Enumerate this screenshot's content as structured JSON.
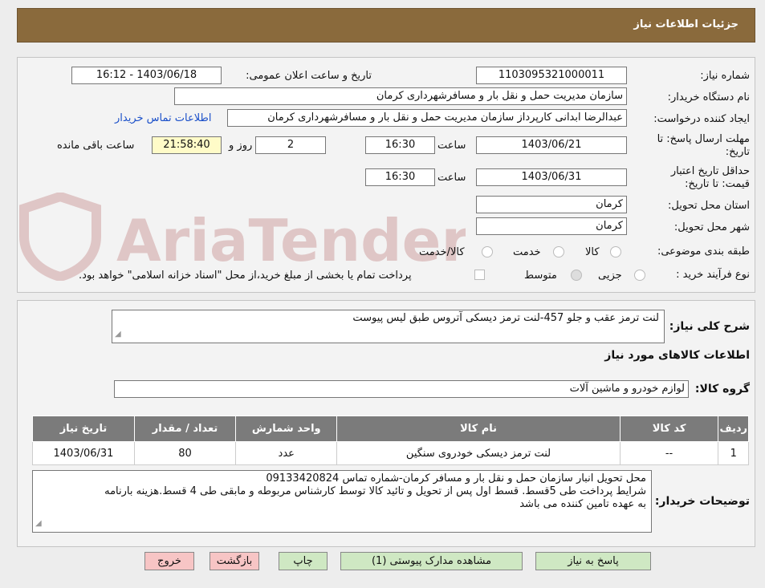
{
  "header": {
    "title": "جزئیات اطلاعات نیاز"
  },
  "form": {
    "need_number_label": "شماره نیاز:",
    "need_number": "1103095321000011",
    "announce_label": "تاریخ و ساعت اعلان عمومی:",
    "announce_value": "1403/06/18 - 16:12",
    "buyer_label": "نام دستگاه خریدار:",
    "buyer": "سازمان مدیریت حمل و نقل بار و مسافرشهرداری کرمان",
    "creator_label": "ایجاد کننده درخواست:",
    "creator": "عبدالرضا ابدانی کارپرداز سازمان مدیریت حمل و نقل بار و مسافرشهرداری کرمان",
    "contact_link": "اطلاعات تماس خریدار",
    "deadline_label": "مهلت ارسال پاسخ: تا تاریخ:",
    "deadline_date": "1403/06/21",
    "time_label": "ساعت",
    "deadline_time": "16:30",
    "days_value": "2",
    "days_label": "روز و",
    "remaining_time": "21:58:40",
    "remaining_label": "ساعت باقی مانده",
    "validity_label": "حداقل تاریخ اعتبار قیمت: تا تاریخ:",
    "validity_date": "1403/06/31",
    "validity_time": "16:30",
    "province_label": "استان محل تحویل:",
    "province": "کرمان",
    "city_label": "شهر محل تحویل:",
    "city": "کرمان",
    "category_label": "طبقه بندی موضوعی:",
    "cat_goods": "کالا",
    "cat_service": "خدمت",
    "cat_both": "کالا/خدمت",
    "process_label": "نوع فرآیند خرید :",
    "proc_partial": "جزیی",
    "proc_medium": "متوسط",
    "payment_note": "پرداخت تمام یا بخشی از مبلغ خرید،از محل \"اسناد خزانه اسلامی\" خواهد بود."
  },
  "summary": {
    "label": "شرح کلی نیاز:",
    "value": "لنت ترمز عقب و جلو 457-لنت ترمز دیسکی آتروس طبق لیس پیوست",
    "items_heading": "اطلاعات کالاهای مورد نیاز",
    "group_label": "گروه کالا:",
    "group_value": "لوازم خودرو و ماشین آلات"
  },
  "table": {
    "headers": [
      "ردیف",
      "کد کالا",
      "نام کالا",
      "واحد شمارش",
      "تعداد / مقدار",
      "تاریخ نیاز"
    ],
    "rows": [
      [
        "1",
        "--",
        "لنت ترمز دیسکی خودروی سنگین",
        "عدد",
        "80",
        "1403/06/31"
      ]
    ]
  },
  "notes": {
    "label": "توضیحات خریدار:",
    "line1": "محل تحویل انبار سازمان حمل و نقل بار و مسافر کرمان-شماره تماس 09133420824",
    "line2": "شرایط پرداخت طی 5قسط. قسط اول پس از تحویل و تائید کالا توسط کارشناس مربوطه و مابقی طی 4 قسط.هزینه بارنامه",
    "line3": "به عهده تامین کننده می باشد"
  },
  "buttons": {
    "reply": "پاسخ به نیاز",
    "attachments": "مشاهده مدارک پیوستی (1)",
    "print": "چاپ",
    "back": "بازگشت",
    "exit": "خروج"
  },
  "watermark": {
    "text": "AriaTender.neT"
  },
  "colors": {
    "header_bg": "#8a6a3c",
    "table_header": "#7b7b7b",
    "green_button": "#cfe8c3",
    "pink_button": "#f7c5c5",
    "remaining_bg": "#fffbc8",
    "link": "#1a4fc9"
  }
}
